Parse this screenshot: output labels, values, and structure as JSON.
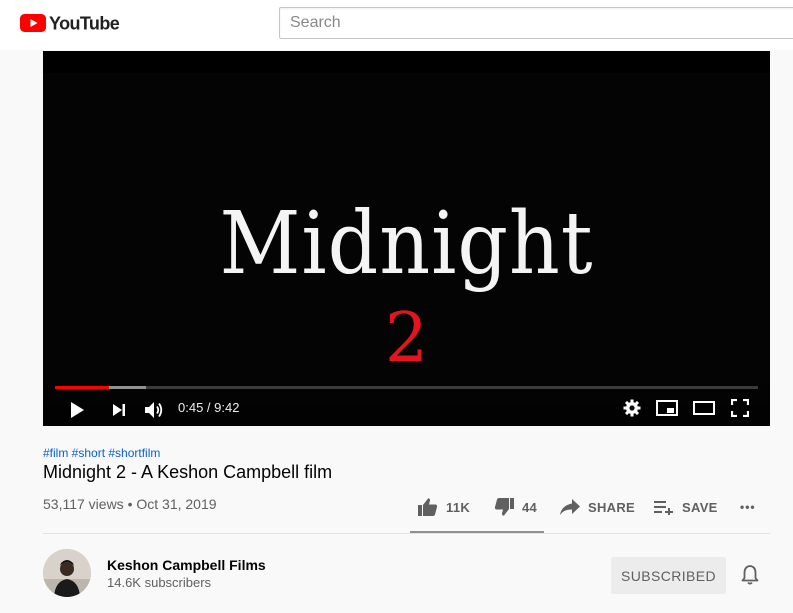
{
  "header": {
    "logo_text": "YouTube",
    "search_placeholder": "Search"
  },
  "player": {
    "title_card_line1": "Midnight",
    "title_card_line2": "2",
    "current_time": "0:45",
    "duration": "9:42",
    "time_display": "0:45 / 9:42",
    "played_fraction": 0.077,
    "buffered_fraction": 0.13
  },
  "video": {
    "hashtags": "#film #short #shortfilm",
    "title": "Midnight 2 - A Keshon Campbell film",
    "meta": "53,117 views • Oct 31, 2019"
  },
  "actions": {
    "like_count": "11K",
    "dislike_count": "44",
    "share_label": "SHARE",
    "save_label": "SAVE",
    "more_label": "•••"
  },
  "channel": {
    "name": "Keshon Campbell Films",
    "subscribers": "14.6K subscribers",
    "subscribe_label": "SUBSCRIBED"
  },
  "colors": {
    "accent_red": "#ff0000",
    "link_blue": "#065fd4",
    "title_card_red": "#e3141e"
  }
}
